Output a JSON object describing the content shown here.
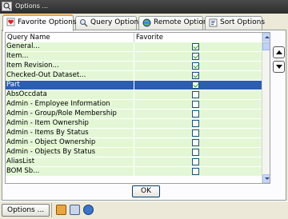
{
  "window": {
    "title": "Options ..."
  },
  "tabs": [
    {
      "label": "Favorite Options",
      "icon": "favorite-heart-icon",
      "active": true
    },
    {
      "label": "Query Options",
      "icon": "query-magnifier-icon",
      "active": false
    },
    {
      "label": "Remote Option",
      "icon": "remote-globe-icon",
      "active": false
    },
    {
      "label": "Sort Options",
      "icon": "sort-list-icon",
      "active": false
    }
  ],
  "grid": {
    "columns": [
      "Query Name",
      "Favorite"
    ],
    "rows": [
      {
        "name": "General...",
        "favorite": true
      },
      {
        "name": "Item...",
        "favorite": true
      },
      {
        "name": "Item Revision...",
        "favorite": true
      },
      {
        "name": "Checked-Out Dataset...",
        "favorite": true
      },
      {
        "name": "Part",
        "favorite": true,
        "selected": true
      },
      {
        "name": "AbsOccdata",
        "favorite": false
      },
      {
        "name": "Admin - Employee Information",
        "favorite": false
      },
      {
        "name": "Admin - Group/Role Membership",
        "favorite": false
      },
      {
        "name": "Admin - Item Ownership",
        "favorite": false
      },
      {
        "name": "Admin - Items By Status",
        "favorite": false
      },
      {
        "name": "Admin - Object Ownership",
        "favorite": false
      },
      {
        "name": "Admin - Objects By Status",
        "favorite": false
      },
      {
        "name": "AliasList",
        "favorite": false
      },
      {
        "name": "BOM Sb...",
        "favorite": false
      }
    ]
  },
  "buttons": {
    "ok": "OK",
    "options": "Options ..."
  },
  "status_icons": [
    "query-icon",
    "settings-icon",
    "navigate-icon"
  ],
  "colors": {
    "row_bg": "#e3f7d6",
    "selected_bg": "#2c5dae",
    "active_tab_accent": "#f3a02b"
  }
}
